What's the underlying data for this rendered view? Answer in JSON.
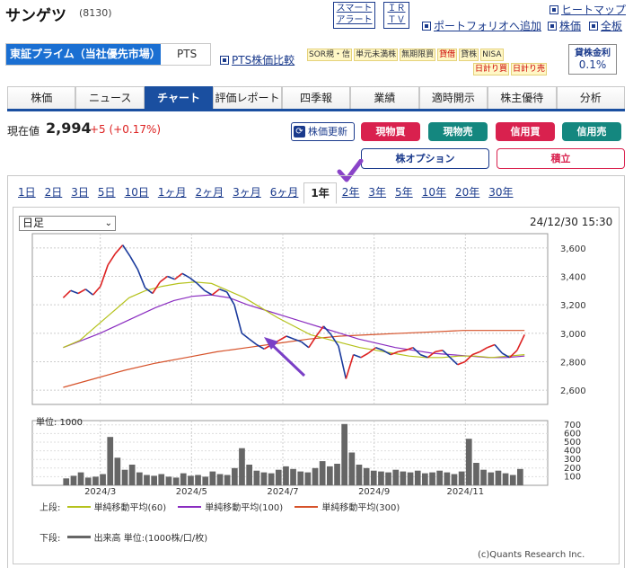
{
  "header": {
    "company": "サンゲツ",
    "code": "(8130)",
    "smart_alert": [
      "スマート",
      "アラート"
    ],
    "ir_tv": [
      "ＩＲ",
      "ＴＶ"
    ],
    "heatmap": "ヒートマップ",
    "portfolio_add": "ポートフォリオへ追加",
    "stock_price": "株価",
    "all_stocks": "全板"
  },
  "market": {
    "selected": "東証プライム（当社優先市場）",
    "other": "PTS",
    "pts_compare": "PTS株価比較"
  },
  "tags_row1": [
    "SOR規・信",
    "単元未満株",
    "無期限買",
    "貸借",
    "貸株",
    "NISA"
  ],
  "tags_row2": [
    "日計り買",
    "日計り売"
  ],
  "lending": {
    "label": "貸株金利",
    "value": "0.1%"
  },
  "tabs": [
    "株価",
    "ニュース",
    "チャート",
    "評価レポート",
    "四季報",
    "業績",
    "適時開示",
    "株主優待",
    "分析"
  ],
  "price": {
    "label": "現在値",
    "value": "2,994",
    "change": "+5 (+0.17%)",
    "refresh": "株価更新"
  },
  "actions": {
    "cash_buy": "現物買",
    "cash_sell": "現物売",
    "margin_buy": "信用買",
    "margin_sell": "信用売",
    "option": "株オプション",
    "accumulate": "積立"
  },
  "periods": [
    "1日",
    "2日",
    "3日",
    "5日",
    "10日",
    "1ヶ月",
    "2ヶ月",
    "3ヶ月",
    "6ヶ月",
    "1年",
    "2年",
    "3年",
    "5年",
    "10年",
    "20年",
    "30年"
  ],
  "chart": {
    "interval": "日足",
    "timestamp": "24/12/30 15:30",
    "volume_unit": "単位: 1000",
    "copyright": "(c)Quants Research Inc.",
    "legend": {
      "upper_label": "上段:",
      "ma60": "単純移動平均(60)",
      "ma100": "単純移動平均(100)",
      "ma300": "単純移動平均(300)",
      "lower_label": "下段:",
      "volume": "出来高 単位:(1000株/口/枚)"
    }
  },
  "colors": {
    "accent": "#1a4fa0",
    "buy": "#d9214e",
    "sell": "#14877f",
    "ma60": "#b5c21c",
    "ma100": "#8a2cc0",
    "ma300": "#d6522a",
    "candle_up": "#d22",
    "candle_down": "#1a3a9c"
  },
  "chart_data": {
    "type": "line",
    "x_ticks": [
      "2024/3",
      "2024/5",
      "2024/7",
      "2024/9",
      "2024/11"
    ],
    "y_ticks": [
      2600,
      2800,
      3000,
      3200,
      3400,
      3600
    ],
    "ylim": [
      2500,
      3700
    ],
    "price_series": [
      3250,
      3300,
      3280,
      3310,
      3270,
      3330,
      3480,
      3560,
      3620,
      3540,
      3450,
      3320,
      3280,
      3360,
      3400,
      3380,
      3420,
      3390,
      3350,
      3300,
      3270,
      3310,
      3290,
      3200,
      3000,
      2960,
      2920,
      2890,
      2920,
      2950,
      2980,
      2960,
      2940,
      2900,
      2980,
      3050,
      2990,
      2910,
      2680,
      2850,
      2830,
      2860,
      2900,
      2880,
      2850,
      2870,
      2880,
      2900,
      2850,
      2830,
      2870,
      2880,
      2830,
      2780,
      2800,
      2850,
      2870,
      2900,
      2920,
      2860,
      2830,
      2880,
      2990
    ],
    "ma60": [
      2900,
      2950,
      3050,
      3150,
      3250,
      3300,
      3330,
      3350,
      3360,
      3350,
      3300,
      3250,
      3180,
      3110,
      3050,
      2990,
      2960,
      2930,
      2900,
      2880,
      2860,
      2840,
      2830,
      2830,
      2840,
      2840,
      2830,
      2840,
      2850
    ],
    "ma100": [
      2900,
      2950,
      3000,
      3060,
      3120,
      3180,
      3230,
      3260,
      3270,
      3250,
      3200,
      3160,
      3120,
      3080,
      3040,
      3000,
      2960,
      2930,
      2900,
      2880,
      2860,
      2850,
      2840,
      2830,
      2830,
      2840
    ],
    "ma300": [
      2620,
      2680,
      2740,
      2790,
      2830,
      2870,
      2900,
      2930,
      2960,
      2980,
      2990,
      3000,
      3010,
      3020,
      3020,
      3020
    ],
    "volume_ticks": [
      100,
      200,
      300,
      400,
      500,
      600,
      700
    ],
    "volume": [
      80,
      110,
      150,
      90,
      100,
      130,
      560,
      320,
      180,
      240,
      150,
      120,
      110,
      130,
      100,
      90,
      140,
      110,
      120,
      100,
      160,
      130,
      120,
      200,
      430,
      240,
      170,
      150,
      140,
      180,
      220,
      190,
      160,
      150,
      200,
      280,
      220,
      250,
      710,
      380,
      240,
      200,
      170,
      160,
      150,
      180,
      160,
      150,
      170,
      140,
      150,
      170,
      150,
      130,
      160,
      540,
      260,
      180,
      150,
      170,
      140,
      120,
      190
    ]
  }
}
